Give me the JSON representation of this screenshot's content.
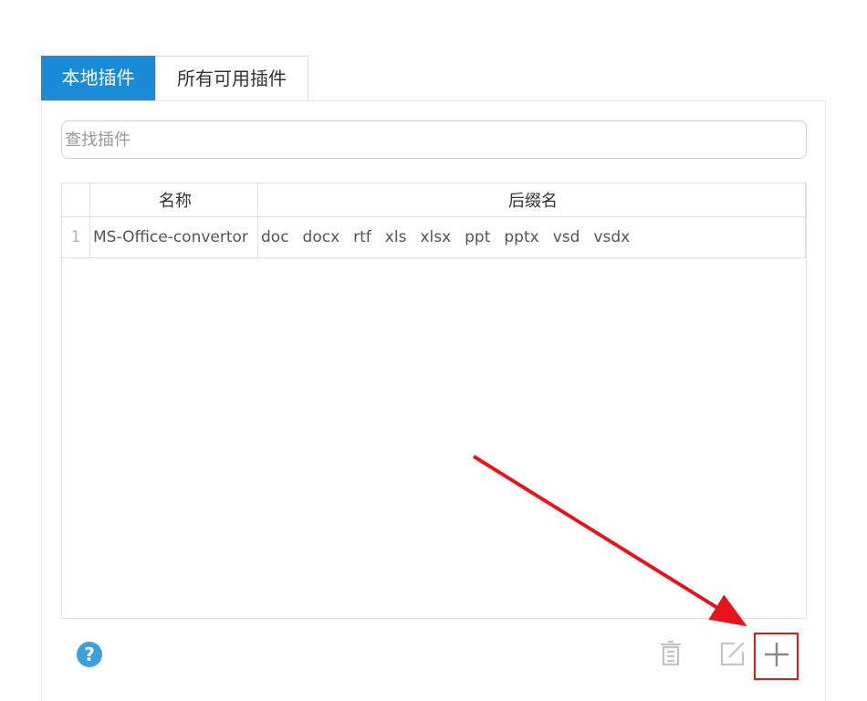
{
  "tabs": [
    {
      "label": "本地插件",
      "active": true
    },
    {
      "label": "所有可用插件",
      "active": false
    }
  ],
  "search": {
    "placeholder": "查找插件",
    "value": ""
  },
  "table": {
    "columns": [
      "名称",
      "后缀名"
    ],
    "rows": [
      {
        "index": "1",
        "name": "MS-Office-convertor",
        "extensions": [
          "doc",
          "docx",
          "rtf",
          "xls",
          "xlsx",
          "ppt",
          "pptx",
          "vsd",
          "vsdx"
        ]
      }
    ]
  },
  "footer": {
    "help_label": "?",
    "icons": [
      "trash-icon",
      "edit-icon",
      "plus-icon"
    ]
  },
  "colors": {
    "accent": "#1a8bd6",
    "help": "#3c9fe0",
    "annotation": "#e8141b",
    "icon_gray": "#c4c4c4",
    "plus_gray": "#888888"
  }
}
